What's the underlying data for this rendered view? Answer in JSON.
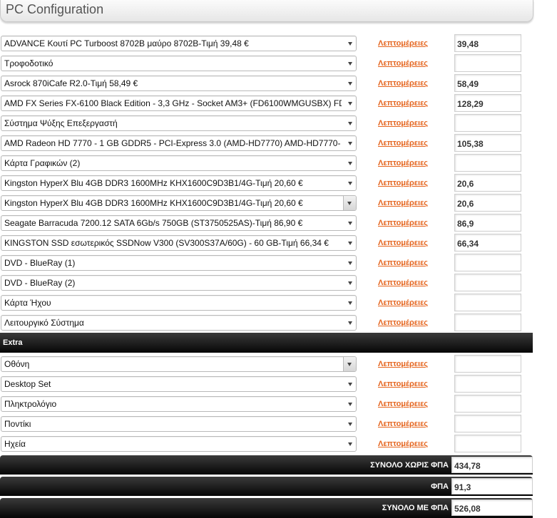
{
  "page": {
    "title": "PC Configuration"
  },
  "link_label": "Λεπτομέρειες",
  "components": [
    {
      "select": "ADVANCE Κουτί PC Turboost 8702B μαύρο 8702B-Τιμή 39,48 €",
      "price": "39,48"
    },
    {
      "select": "Τροφοδοτικό",
      "price": ""
    },
    {
      "select": "Asrock 870iCafe R2.0-Τιμή 58,49 €",
      "price": "58,49"
    },
    {
      "select": "AMD FX Series FX-6100 Black Edition - 3,3 GHz - Socket AM3+ (FD6100WMGUSBX) FD",
      "price": "128,29"
    },
    {
      "select": "Σύστημα Ψύξης Επεξεργαστή",
      "price": ""
    },
    {
      "select": "AMD Radeon HD 7770 - 1 GB GDDR5 - PCI-Express 3.0 (AMD-HD7770) AMD-HD7770-",
      "price": "105,38"
    },
    {
      "select": "Κάρτα Γραφικών (2)",
      "price": ""
    },
    {
      "select": "Kingston HyperX Blu 4GB DDR3 1600MHz KHX1600C9D3B1/4G-Τιμή 20,60 €",
      "price": "20,6"
    },
    {
      "select": "Kingston HyperX Blu 4GB DDR3 1600MHz KHX1600C9D3B1/4G-Τιμή 20,60 €",
      "price": "20,6",
      "focused": true
    },
    {
      "select": "Seagate Barracuda 7200.12 SATA 6Gb/s 750GB (ST3750525AS)-Τιμή 86,90 €",
      "price": "86,9"
    },
    {
      "select": "KINGSTON SSD εσωτερικός SSDNow V300 (SV300S37A/60G) - 60 GB-Τιμή 66,34 €",
      "price": "66,34"
    },
    {
      "select": "DVD - BlueRay (1)",
      "price": ""
    },
    {
      "select": "DVD - BlueRay (2)",
      "price": ""
    },
    {
      "select": "Κάρτα Ήχου",
      "price": ""
    },
    {
      "select": "Λειτουργικό Σύστημα",
      "price": ""
    }
  ],
  "extra": {
    "label": "Extra",
    "items": [
      {
        "select": "Οθόνη",
        "price": "",
        "focused": true
      },
      {
        "select": "Desktop Set",
        "price": ""
      },
      {
        "select": "Πληκτρολόγιο",
        "price": ""
      },
      {
        "select": "Ποντίκι",
        "price": ""
      },
      {
        "select": "Ηχεία",
        "price": ""
      }
    ]
  },
  "totals": [
    {
      "label": "ΣΥΝΟΛΟ ΧΩΡΙΣ ΦΠΑ",
      "value": "434,78"
    },
    {
      "label": "ΦΠΑ",
      "value": "91,3"
    },
    {
      "label": "ΣΥΝΟΛΟ ΜΕ ΦΠΑ",
      "value": "526,08"
    }
  ]
}
